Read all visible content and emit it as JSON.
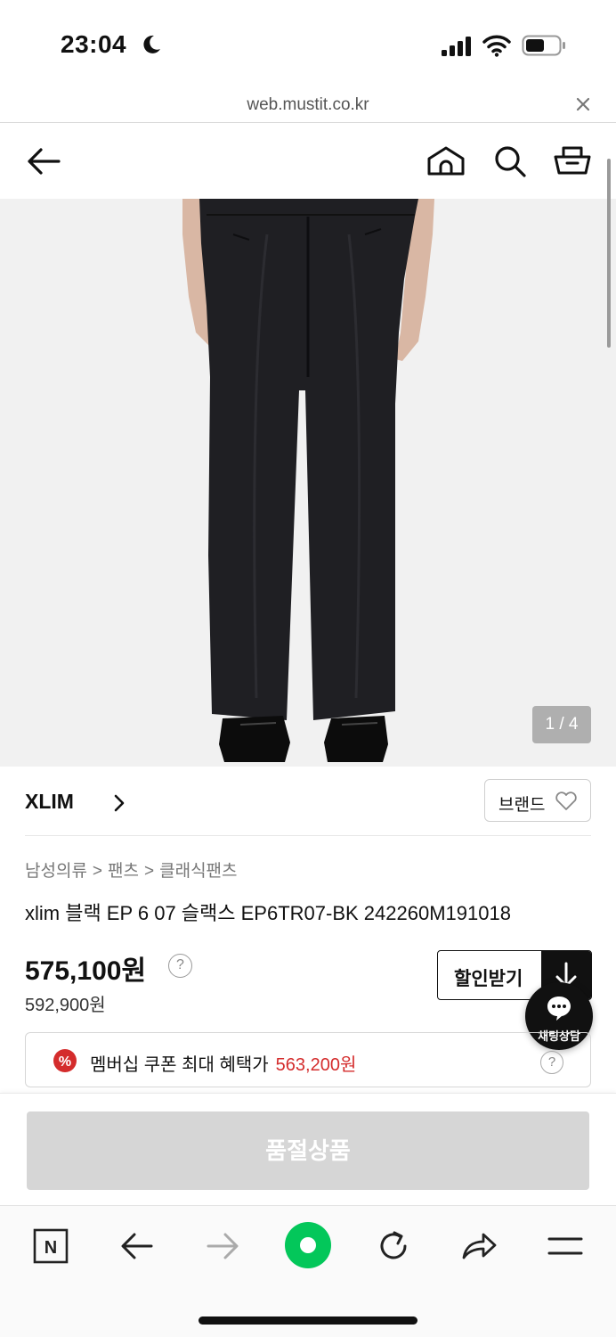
{
  "status_bar": {
    "time": "23:04"
  },
  "url_bar": {
    "url": "web.mustit.co.kr"
  },
  "product": {
    "image_counter": "1 / 4",
    "brand": "XLIM",
    "brand_button_label": "브랜드",
    "breadcrumb": [
      "남성의류",
      "팬츠",
      "클래식팬츠"
    ],
    "breadcrumb_separator": ">",
    "title": "xlim 블랙 EP 6 07 슬랙스 EP6TR07-BK 242260M191018",
    "price": "575,100원",
    "original_price": "592,900원",
    "discount_button_label": "할인받기",
    "help_glyph": "?"
  },
  "chat": {
    "label": "채팅상담"
  },
  "coupon": {
    "text": "멤버십 쿠폰 최대 혜택가",
    "price": "563,200원",
    "icon_glyph": "%"
  },
  "soldout": {
    "label": "품절상품"
  },
  "colors": {
    "accent_red": "#d42c2c",
    "naver_green": "#03c75a",
    "soldout_gray": "#d6d6d6"
  },
  "icons": {
    "status": [
      "moon-icon",
      "signal-icon",
      "wifi-icon",
      "battery-icon"
    ],
    "header": [
      "back-arrow-icon",
      "home-icon",
      "search-icon",
      "cart-icon"
    ],
    "browser_bar": [
      "naver-n-icon",
      "browser-back-icon",
      "browser-forward-icon",
      "naver-green-dot-icon",
      "reload-icon",
      "share-icon",
      "menu-icon"
    ]
  },
  "browser_bar": {
    "naver_glyph": "N"
  }
}
